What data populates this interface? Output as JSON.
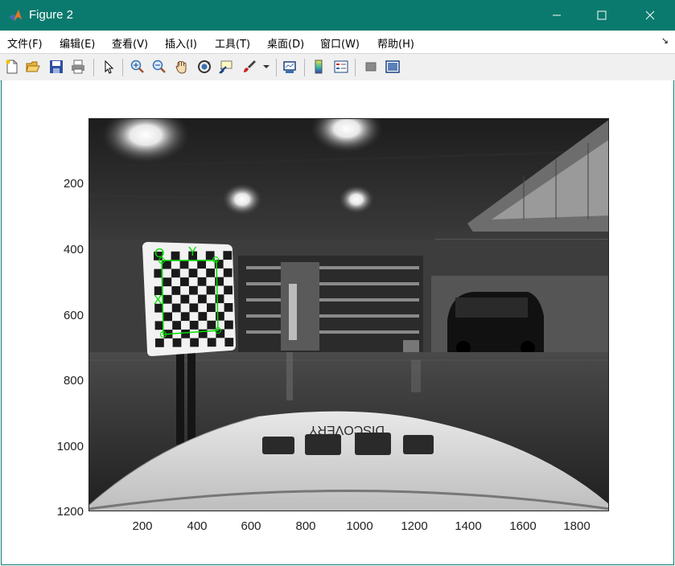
{
  "window": {
    "title": "Figure 2"
  },
  "menu": [
    {
      "label": "文件(F)"
    },
    {
      "label": "编辑(E)"
    },
    {
      "label": "查看(V)"
    },
    {
      "label": "插入(I)"
    },
    {
      "label": "工具(T)"
    },
    {
      "label": "桌面(D)"
    },
    {
      "label": "窗口(W)"
    },
    {
      "label": "帮助(H)"
    }
  ],
  "toolbar": {
    "icons": [
      "new-figure-icon",
      "open-file-icon",
      "save-icon",
      "print-icon",
      "pointer-icon",
      "zoom-in-icon",
      "zoom-out-icon",
      "pan-hand-icon",
      "rotate-3d-icon",
      "data-cursor-icon",
      "brush-icon",
      "link-plot-icon",
      "colorbar-icon",
      "legend-icon",
      "hide-plot-tools-icon",
      "show-plot-tools-icon"
    ]
  },
  "axes": {
    "yticks": [
      "200",
      "400",
      "600",
      "800",
      "1000",
      "1200"
    ],
    "xticks": [
      "200",
      "400",
      "600",
      "800",
      "1000",
      "1200",
      "1400",
      "1600",
      "1800"
    ]
  },
  "image": {
    "overlay_labels": {
      "origin": "O",
      "x_axis": "X",
      "y_axis": "Y"
    },
    "car_hood_text": "DISCOVERY"
  },
  "colors": {
    "titlebar": "#0b7a6e",
    "overlay": "#00e000"
  }
}
